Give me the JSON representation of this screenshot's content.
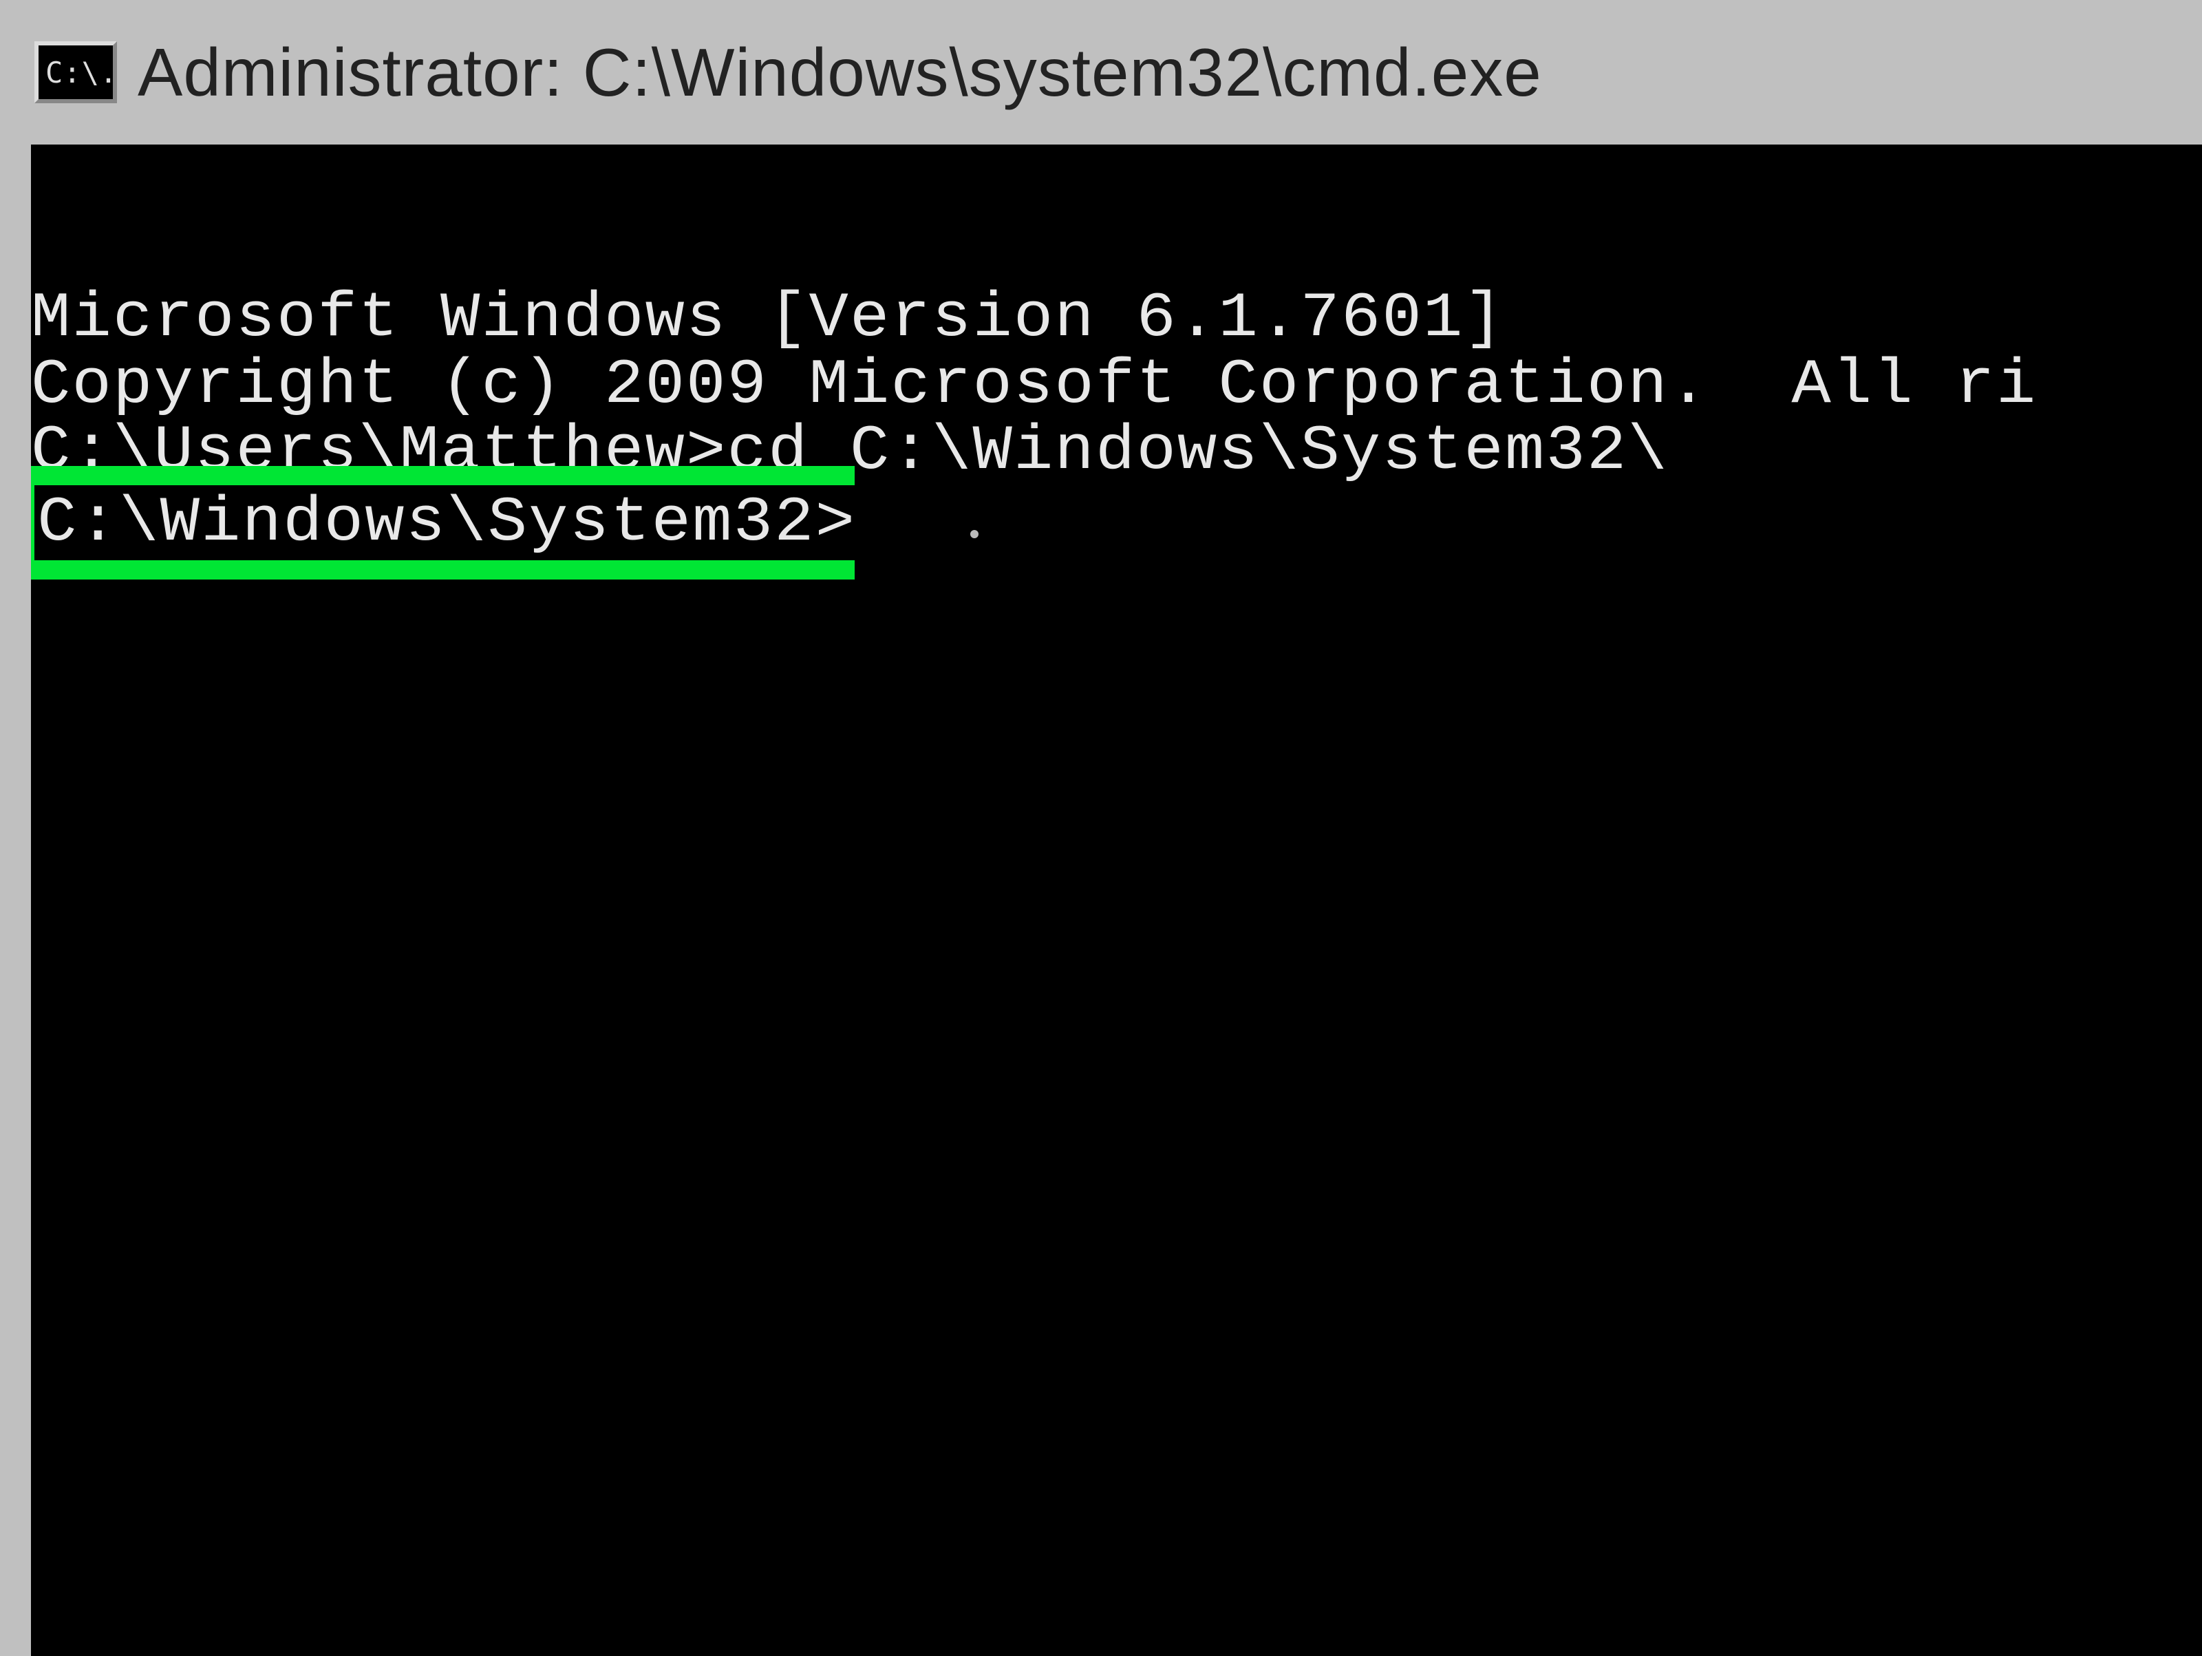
{
  "titlebar": {
    "icon_text": "C:\\.",
    "title": "Administrator: C:\\Windows\\system32\\cmd.exe"
  },
  "terminal": {
    "line1": "Microsoft Windows [Version 6.1.7601]",
    "line2": "Copyright (c) 2009 Microsoft Corporation.  All ri",
    "line3": "",
    "line4_prompt": "C:\\Users\\Matthew>",
    "line4_command": "cd C:\\Windows\\System32\\",
    "highlighted_prompt": "C:\\Windows\\System32>"
  }
}
